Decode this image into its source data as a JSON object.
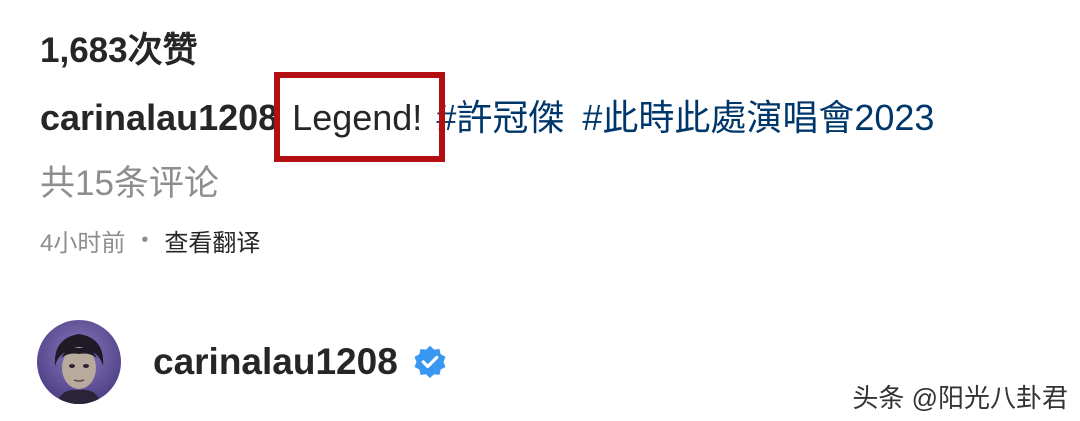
{
  "post": {
    "likes_count": "1,683次赞",
    "caption": {
      "username": "carinalau1208",
      "text": "Legend!",
      "hashtags": [
        "#許冠傑",
        "#此時此處演唱會2023"
      ]
    },
    "comments_label": "共15条评论",
    "time_ago": "4小时前",
    "separator": "•",
    "translate_label": "查看翻译"
  },
  "author": {
    "username": "carinalau1208",
    "avatar_icon": "avatar-portrait",
    "verified_icon": "verified-badge-icon",
    "verified_color": "#3897f0"
  },
  "watermark": {
    "text": "头条 @阳光八卦君"
  },
  "colors": {
    "primary_text": "#262626",
    "secondary_text": "#8e8e8e",
    "hashtag": "#00376b",
    "highlight_box": "#b30f13"
  }
}
